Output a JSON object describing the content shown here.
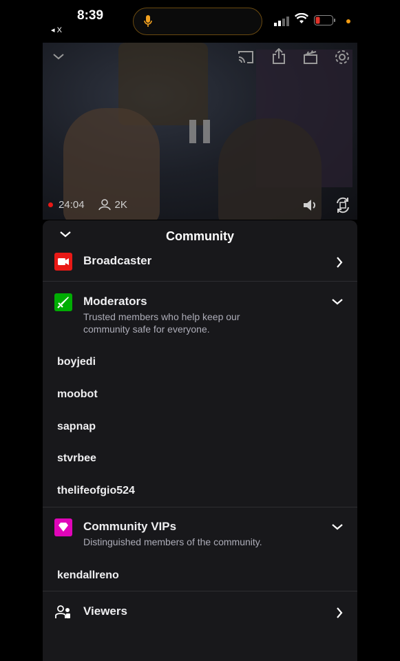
{
  "status_bar": {
    "time": "8:39",
    "back_app": "◂ X"
  },
  "video": {
    "live_time": "24:04",
    "viewer_count": "2K"
  },
  "panel": {
    "title": "Community",
    "broadcaster": {
      "label": "Broadcaster",
      "icon": "camera-icon",
      "color": "#e91916"
    },
    "moderators": {
      "label": "Moderators",
      "description_line1": "Trusted members who help keep our",
      "description_line2": "community safe for everyone.",
      "icon": "sword-icon",
      "color": "#00ad03",
      "users": [
        "boyjedi",
        "moobot",
        "sapnap",
        "stvrbee",
        "thelifeofgio524"
      ]
    },
    "vips": {
      "label": "Community VIPs",
      "description": "Distinguished members of the community.",
      "icon": "gem-icon",
      "color": "#e005b9",
      "users": [
        "kendallreno"
      ]
    },
    "viewers": {
      "label": "Viewers",
      "icon": "people-icon"
    }
  }
}
